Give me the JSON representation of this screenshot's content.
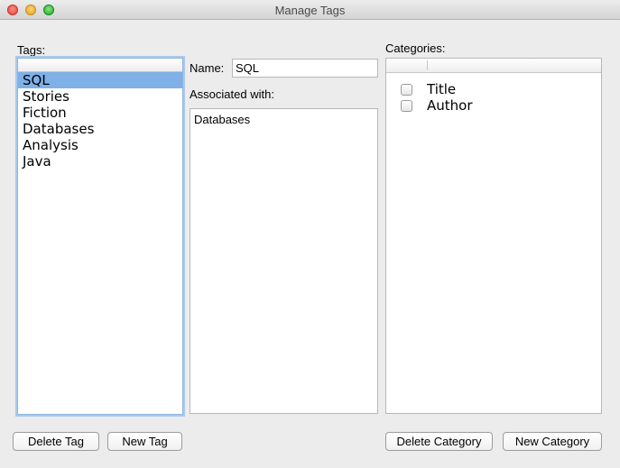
{
  "window": {
    "title": "Manage Tags"
  },
  "tags": {
    "label": "Tags:",
    "items": [
      "SQL",
      "Stories",
      "Fiction",
      "Databases",
      "Analysis",
      "Java"
    ],
    "selected": "SQL"
  },
  "details": {
    "name_label": "Name:",
    "name_value": "SQL",
    "associated_label": "Associated with:",
    "associated_items": [
      "Databases"
    ]
  },
  "categories": {
    "label": "Categories:",
    "items": [
      {
        "label": "Title",
        "checked": false
      },
      {
        "label": "Author",
        "checked": false
      }
    ]
  },
  "buttons": {
    "delete_tag": "Delete Tag",
    "new_tag": "New Tag",
    "delete_category": "Delete Category",
    "new_category": "New Category"
  },
  "colors": {
    "selection": "#7fb0e8",
    "focus_ring": "#a9c9ee"
  }
}
